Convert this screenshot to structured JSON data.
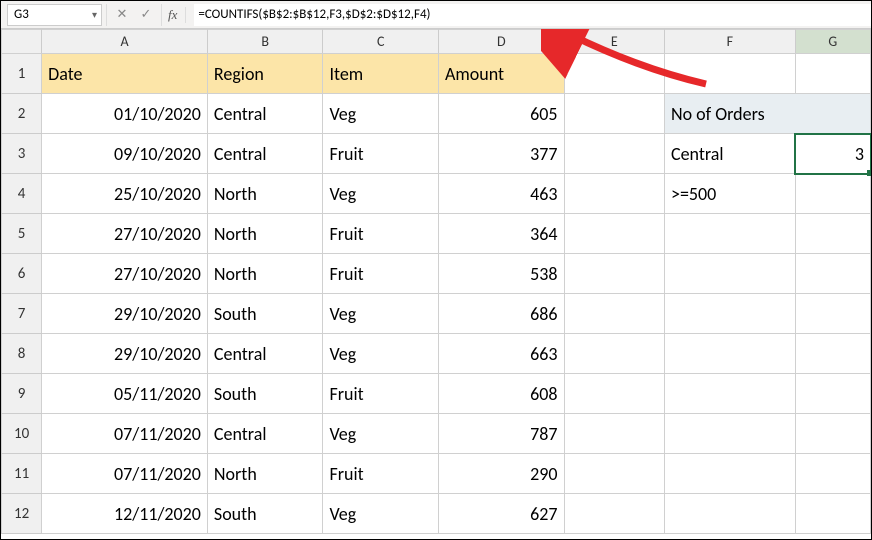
{
  "name_box": "G3",
  "formula": "=COUNTIFS($B$2:$B$12,F3,$D$2:$D$12,F4)",
  "columns": [
    "",
    "A",
    "B",
    "C",
    "D",
    "E",
    "F",
    "G"
  ],
  "headers": {
    "A": "Date",
    "B": "Region",
    "C": "Item",
    "D": "Amount"
  },
  "rows": [
    {
      "n": "1"
    },
    {
      "n": "2",
      "A": "01/10/2020",
      "B": "Central",
      "C": "Veg",
      "D": "605",
      "F": "No of Orders"
    },
    {
      "n": "3",
      "A": "09/10/2020",
      "B": "Central",
      "C": "Fruit",
      "D": "377",
      "F": "Central",
      "G": "3"
    },
    {
      "n": "4",
      "A": "25/10/2020",
      "B": "North",
      "C": "Veg",
      "D": "463",
      "F": ">=500"
    },
    {
      "n": "5",
      "A": "27/10/2020",
      "B": "North",
      "C": "Fruit",
      "D": "364"
    },
    {
      "n": "6",
      "A": "27/10/2020",
      "B": "North",
      "C": "Fruit",
      "D": "538"
    },
    {
      "n": "7",
      "A": "29/10/2020",
      "B": "South",
      "C": "Veg",
      "D": "686"
    },
    {
      "n": "8",
      "A": "29/10/2020",
      "B": "Central",
      "C": "Veg",
      "D": "663"
    },
    {
      "n": "9",
      "A": "05/11/2020",
      "B": "South",
      "C": "Fruit",
      "D": "608"
    },
    {
      "n": "10",
      "A": "07/11/2020",
      "B": "Central",
      "C": "Veg",
      "D": "787"
    },
    {
      "n": "11",
      "A": "07/11/2020",
      "B": "North",
      "C": "Fruit",
      "D": "290"
    },
    {
      "n": "12",
      "A": "12/11/2020",
      "B": "South",
      "C": "Veg",
      "D": "627"
    }
  ]
}
